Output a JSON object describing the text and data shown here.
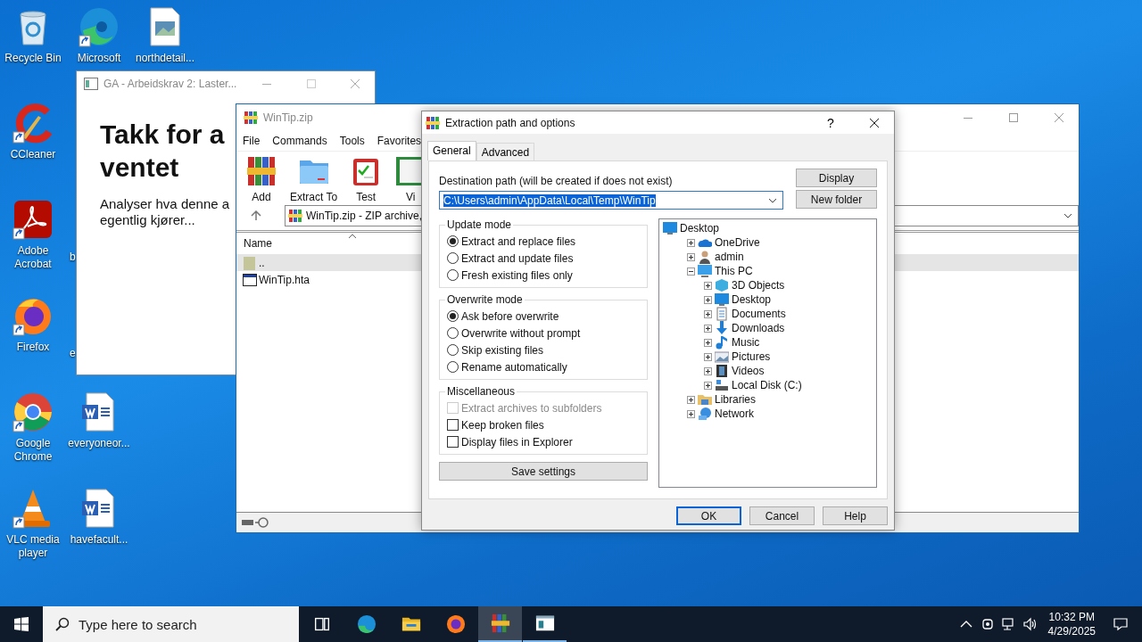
{
  "desktop_icons": [
    {
      "label": "Recycle Bin",
      "kind": "recycle",
      "shortcut": false
    },
    {
      "label": "Microsoft",
      "kind": "edge",
      "shortcut": true
    },
    {
      "label": "northdetail...",
      "kind": "image",
      "shortcut": false
    },
    {
      "label": "CCleaner",
      "kind": "ccleaner",
      "shortcut": true
    },
    {
      "label": "Adobe Acrobat",
      "kind": "acrobat",
      "shortcut": true
    },
    {
      "label": "b",
      "kind": "covered"
    },
    {
      "label": "Firefox",
      "kind": "firefox",
      "shortcut": true
    },
    {
      "label": "e",
      "kind": "covered"
    },
    {
      "label": "Google Chrome",
      "kind": "chrome",
      "shortcut": true
    },
    {
      "label": "everyoneor...",
      "kind": "word",
      "shortcut": false
    },
    {
      "label": "VLC media player",
      "kind": "vlc",
      "shortcut": true
    },
    {
      "label": "havefacult...",
      "kind": "word",
      "shortcut": false
    }
  ],
  "browser_window": {
    "title": "GA - Arbeidskrav 2: Laster...",
    "heading": "Takk for a\nventet",
    "text": "Analyser hva denne a\negentlig kjører..."
  },
  "archiver_window": {
    "title": "WinTip.zip",
    "menu": [
      "File",
      "Commands",
      "Tools",
      "Favorites"
    ],
    "toolbar": [
      {
        "label": "Add",
        "kind": "add"
      },
      {
        "label": "Extract To",
        "kind": "extract"
      },
      {
        "label": "Test",
        "kind": "test"
      },
      {
        "label": "Vi",
        "kind": "view"
      }
    ],
    "address": "WinTip.zip - ZIP archive,",
    "columns": [
      "Name"
    ],
    "files": [
      {
        "name": "..",
        "kind": "folder",
        "selected": true
      },
      {
        "name": "WinTip.hta",
        "kind": "hta",
        "selected": false
      }
    ]
  },
  "dialog": {
    "title": "Extraction path and options",
    "help": "?",
    "tabs": [
      {
        "label": "General",
        "selected": true
      },
      {
        "label": "Advanced",
        "selected": false
      }
    ],
    "destination_label": "Destination path (will be created if does not exist)",
    "destination": {
      "value": "C:\\Users\\admin\\AppData\\Local\\Temp\\WinTip",
      "selected": true
    },
    "side_buttons": [
      "Display",
      "New folder"
    ],
    "groups": [
      {
        "title": "Update mode",
        "options": [
          {
            "label": "Extract and replace files",
            "kind": "radio",
            "checked": true,
            "disabled": false
          },
          {
            "label": "Extract and update files",
            "kind": "radio",
            "checked": false,
            "disabled": false
          },
          {
            "label": "Fresh existing files only",
            "kind": "radio",
            "checked": false,
            "disabled": false
          }
        ]
      },
      {
        "title": "Overwrite mode",
        "options": [
          {
            "label": "Ask before overwrite",
            "kind": "radio",
            "checked": true,
            "disabled": false
          },
          {
            "label": "Overwrite without prompt",
            "kind": "radio",
            "checked": false,
            "disabled": false
          },
          {
            "label": "Skip existing files",
            "kind": "radio",
            "checked": false,
            "disabled": false
          },
          {
            "label": "Rename automatically",
            "kind": "radio",
            "checked": false,
            "disabled": false
          }
        ]
      },
      {
        "title": "Miscellaneous",
        "options": [
          {
            "label": "Extract archives to subfolders",
            "kind": "checkbox",
            "checked": false,
            "disabled": true
          },
          {
            "label": "Keep broken files",
            "kind": "checkbox",
            "checked": false,
            "disabled": false
          },
          {
            "label": "Display files in Explorer",
            "kind": "checkbox",
            "checked": false,
            "disabled": false
          }
        ]
      }
    ],
    "save_button": "Save settings",
    "tree": [
      {
        "label": "Desktop",
        "kind": "desktop",
        "children": [
          {
            "label": "OneDrive",
            "kind": "cloud",
            "expanded": false
          },
          {
            "label": "admin",
            "kind": "user",
            "expanded": false
          },
          {
            "label": "This PC",
            "kind": "pc",
            "expanded": true,
            "children": [
              {
                "label": "3D Objects",
                "kind": "cube",
                "expanded": false
              },
              {
                "label": "Desktop",
                "kind": "desktop",
                "expanded": false
              },
              {
                "label": "Documents",
                "kind": "document",
                "expanded": false
              },
              {
                "label": "Downloads",
                "kind": "download",
                "expanded": false
              },
              {
                "label": "Music",
                "kind": "music",
                "expanded": false
              },
              {
                "label": "Pictures",
                "kind": "pictures",
                "expanded": false
              },
              {
                "label": "Videos",
                "kind": "video",
                "expanded": false
              },
              {
                "label": "Local Disk (C:)",
                "kind": "disk",
                "expanded": false
              }
            ]
          },
          {
            "label": "Libraries",
            "kind": "libraries",
            "expanded": false
          },
          {
            "label": "Network",
            "kind": "network",
            "expanded": false
          }
        ]
      }
    ],
    "buttons": [
      {
        "label": "OK",
        "default": true
      },
      {
        "label": "Cancel",
        "default": false
      },
      {
        "label": "Help",
        "default": false
      }
    ]
  },
  "taskbar": {
    "search_placeholder": "Type here to search",
    "apps": [
      {
        "kind": "taskview",
        "selected": false,
        "running": false
      },
      {
        "kind": "edge",
        "selected": false,
        "running": false
      },
      {
        "kind": "explorer",
        "selected": false,
        "running": false
      },
      {
        "kind": "firefox",
        "selected": false,
        "running": false
      },
      {
        "kind": "winrar",
        "selected": true,
        "running": true
      },
      {
        "kind": "app",
        "selected": false,
        "running": true
      }
    ],
    "time": "10:32 PM",
    "date": "4/29/2025"
  }
}
